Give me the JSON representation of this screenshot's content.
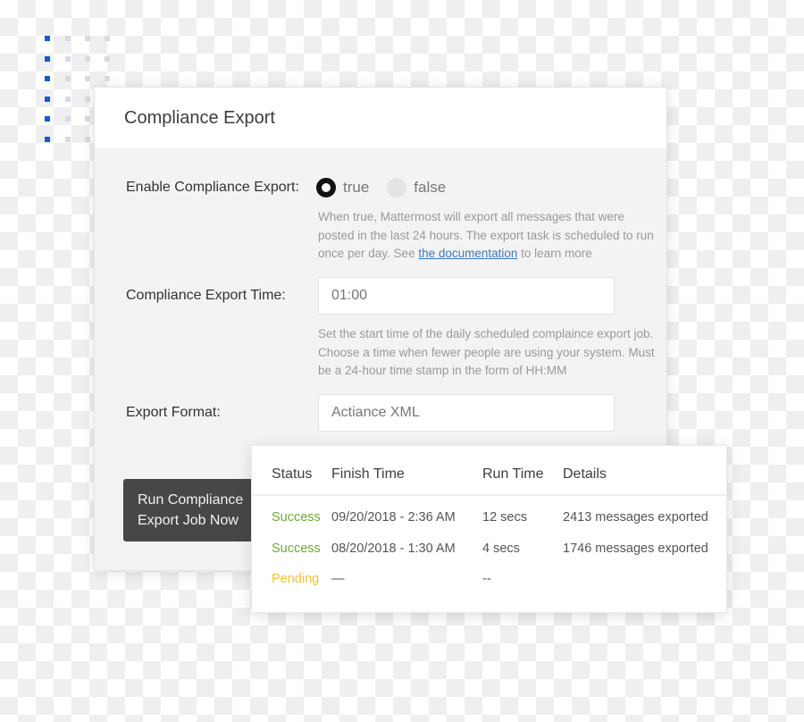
{
  "panel": {
    "title": "Compliance Export",
    "enable": {
      "label": "Enable Compliance Export:",
      "options": [
        {
          "label": "true",
          "selected": true
        },
        {
          "label": "false",
          "selected": false
        }
      ],
      "help_before": "When true, Mattermost will export all messages that were posted in the last 24 hours. The export task is scheduled to run once per day. See ",
      "help_link": "the documentation",
      "help_after": " to learn more"
    },
    "export_time": {
      "label": "Compliance Export Time:",
      "value": "01:00",
      "help": "Set the start time of the daily scheduled complaince export job. Choose a time when fewer people are using your system. Must be a 24-hour time stamp in the form of HH:MM"
    },
    "export_format": {
      "label": "Export Format:",
      "value": "Actiance XML"
    },
    "run_button": {
      "line1": "Run Compliance",
      "line2": "Export Job Now"
    }
  },
  "jobs_table": {
    "headers": [
      "Status",
      "Finish Time",
      "Run Time",
      "Details"
    ],
    "rows": [
      {
        "status": "Success",
        "finish_time": "09/20/2018 - 2:36 AM",
        "run_time": "12 secs",
        "details": "2413 messages exported"
      },
      {
        "status": "Success",
        "finish_time": "08/20/2018 - 1:30 AM",
        "run_time": "4 secs",
        "details": "1746 messages exported"
      },
      {
        "status": "Pending",
        "finish_time": "—",
        "run_time": "--",
        "details": ""
      }
    ]
  },
  "colors": {
    "success": "#6daa36",
    "pending": "#f4c431",
    "link": "#3c79c6",
    "accent_dots": "#1559d6",
    "button_bg": "#474747"
  }
}
